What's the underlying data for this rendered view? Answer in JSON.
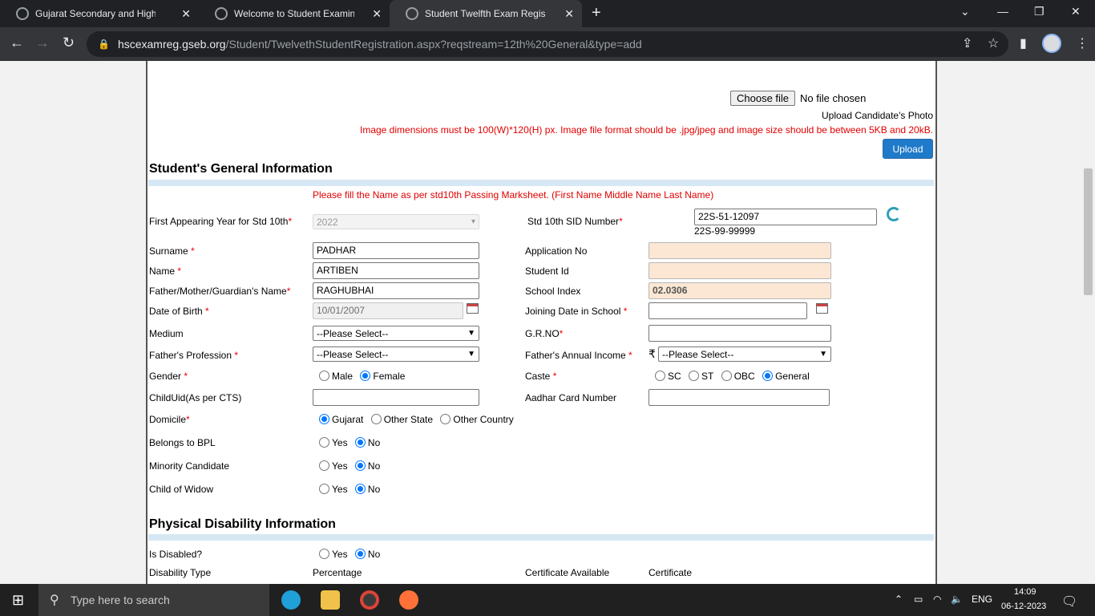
{
  "browser": {
    "tabs": [
      {
        "title": "Gujarat Secondary and Higher Se",
        "active": false
      },
      {
        "title": "Welcome to Student Examinatio",
        "active": false
      },
      {
        "title": "Student Twelfth Exam Registratio",
        "active": true
      }
    ],
    "new_tab": "+",
    "url_host": "hscexamreg.gseb.org",
    "url_path": "/Student/TwelvethStudentRegistration.aspx?reqstream=12th%20General&type=add"
  },
  "photo": {
    "choose_file_label": "Choose file",
    "no_file_text": "No file chosen",
    "upload_caption": "Upload Candidate's Photo",
    "instructions": "Image dimensions must be 100(W)*120(H) px. Image file format should be .jpg/jpeg and image size should be between 5KB and 20kB.",
    "upload_button": "Upload"
  },
  "general": {
    "heading": "Student's General Information",
    "notice": "Please fill the Name as per std10th Passing Marksheet. (First Name Middle Name Last Name)",
    "first_year_label": "First Appearing Year for Std 10th",
    "first_year_value": "2022",
    "sid_label": "Std 10th SID Number",
    "sid_value": "22S-51-12097",
    "sid_hint": "22S-99-99999",
    "surname_label": "Surname",
    "surname_value": "PADHAR",
    "name_label": "Name",
    "name_value": "ARTIBEN",
    "guardian_label": "Father/Mother/Guardian's Name",
    "guardian_value": "RAGHUBHAI",
    "dob_label": "Date of Birth",
    "dob_value": "10/01/2007",
    "application_label": "Application No",
    "application_value": "",
    "student_id_label": "Student Id",
    "student_id_value": "",
    "school_index_label": "School Index",
    "school_index_value": "02.0306",
    "joining_label": "Joining Date in School",
    "joining_value": "",
    "medium_label": "Medium",
    "medium_value": "--Please Select--",
    "grno_label": "G.R.NO",
    "grno_value": "",
    "profession_label": "Father's Profession",
    "profession_value": "--Please Select--",
    "income_label": "Father's Annual Income",
    "income_currency": "₹",
    "income_value": "--Please Select--",
    "gender_label": "Gender",
    "gender_options": [
      "Male",
      "Female"
    ],
    "gender_selected": "Female",
    "caste_label": "Caste",
    "caste_options": [
      "SC",
      "ST",
      "OBC",
      "General"
    ],
    "caste_selected": "General",
    "childuid_label": "ChildUid(As per CTS)",
    "childuid_value": "",
    "aadhar_label": "Aadhar Card Number",
    "aadhar_value": "",
    "domicile_label": "Domicile",
    "domicile_options": [
      "Gujarat",
      "Other State",
      "Other Country"
    ],
    "domicile_selected": "Gujarat",
    "bpl_label": "Belongs to BPL",
    "minority_label": "Minority Candidate",
    "widow_label": "Child of Widow",
    "yes": "Yes",
    "no": "No"
  },
  "disability": {
    "heading": "Physical Disability Information",
    "is_disabled_label": "Is Disabled?",
    "type_label": "Disability Type",
    "percentage_label": "Percentage",
    "cert_available_label": "Certificate Available",
    "certificate_label": "Certificate"
  },
  "taskbar": {
    "search_placeholder": "Type here to search",
    "lang": "ENG",
    "time": "14:09",
    "date": "06-12-2023"
  },
  "colors": {
    "required": "#e00000",
    "accent": "#1f7ac9",
    "section_bar": "#d6e8f3"
  }
}
